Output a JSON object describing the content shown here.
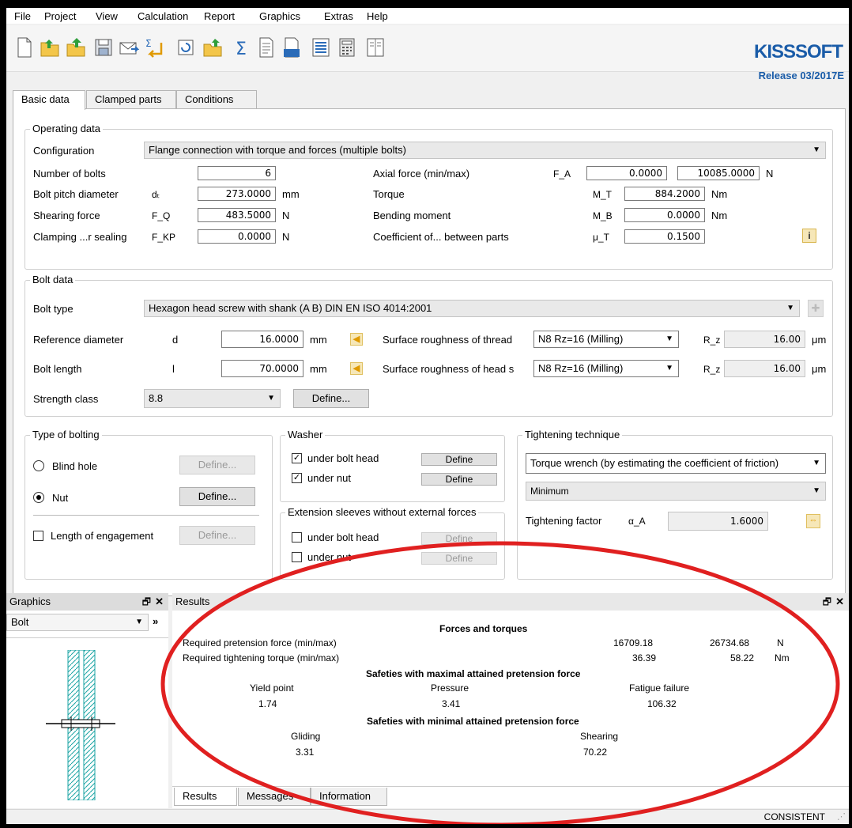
{
  "menu": [
    "File",
    "Project",
    "View",
    "Calculation",
    "Report",
    "Graphics",
    "Extras",
    "Help"
  ],
  "toolbar": {
    "icons": [
      "new-file-icon",
      "open-folder-icon",
      "open-example-icon",
      "save-icon",
      "email-icon",
      "sigma-arrow-icon",
      "rotate-icon",
      "folder-export-icon",
      "sigma-icon",
      "report-icon",
      "report-settings-icon",
      "list-icon",
      "calculator-icon",
      "book-icon"
    ]
  },
  "brand": {
    "logo": "KISSSOFT",
    "release": "Release 03/2017E",
    "accent": "#1a5ca8"
  },
  "tabs": [
    "Basic data",
    "Clamped parts",
    "Conditions"
  ],
  "operating": {
    "title": "Operating data",
    "configuration_label": "Configuration",
    "configuration_value": "Flange connection with torque and forces (multiple bolts)",
    "num_bolts_label": "Number of bolts",
    "num_bolts": "6",
    "pitch_label": "Bolt pitch diameter",
    "pitch_sym": "dₜ",
    "pitch": "273.0000",
    "pitch_unit": "mm",
    "shear_label": "Shearing force",
    "shear_sym": "F_Q",
    "shear": "483.5000",
    "shear_unit": "N",
    "clamp_label": "Clamping ...r sealing",
    "clamp_sym": "F_KP",
    "clamp": "0.0000",
    "clamp_unit": "N",
    "axial_label": "Axial force (min/max)",
    "axial_sym": "F_A",
    "axial_min": "0.0000",
    "axial_max": "10085.0000",
    "axial_unit": "N",
    "torque_label": "Torque",
    "torque_sym": "M_T",
    "torque": "884.2000",
    "torque_unit": "Nm",
    "bending_label": "Bending moment",
    "bending_sym": "M_B",
    "bending": "0.0000",
    "bending_unit": "Nm",
    "coef_label": "Coefficient of... between parts",
    "coef_sym": "μ_T",
    "coef": "0.1500"
  },
  "bolt": {
    "title": "Bolt data",
    "type_label": "Bolt type",
    "type_value": "Hexagon head screw with shank (A B) DIN EN ISO 4014:2001",
    "refdia_label": "Reference diameter",
    "refdia_sym": "d",
    "refdia": "16.0000",
    "refdia_unit": "mm",
    "length_label": "Bolt length",
    "length_sym": "l",
    "length": "70.0000",
    "length_unit": "mm",
    "strength_label": "Strength class",
    "strength_value": "8.8",
    "define": "Define...",
    "rough_thread_label": "Surface roughness of thread",
    "rough_thread_value": "N8  Rz=16  (Milling)",
    "rough_head_label": "Surface roughness of head s",
    "rough_head_value": "N8  Rz=16  (Milling)",
    "rz_sym": "R_z",
    "rz_thread": "16.00",
    "rz_head": "16.00",
    "rz_unit": "μm"
  },
  "bolting": {
    "title": "Type of bolting",
    "blind": "Blind hole",
    "nut": "Nut",
    "engagement": "Length of engagement",
    "define": "Define..."
  },
  "washer": {
    "title": "Washer",
    "head": "under bolt head",
    "nut": "under nut",
    "define": "Define",
    "sleeves_title": "Extension sleeves without external forces"
  },
  "tightening": {
    "title": "Tightening technique",
    "technique": "Torque wrench (by estimating the coefficient of friction)",
    "level": "Minimum",
    "factor_label": "Tightening factor",
    "factor_sym": "α_A",
    "factor": "1.6000"
  },
  "graphics_panel": {
    "title": "Graphics",
    "selector": "Bolt"
  },
  "results": {
    "title": "Results",
    "forces_title": "Forces and torques",
    "pretension_label": "Required pretension force (min/max)",
    "pretension_min": "16709.18",
    "pretension_max": "26734.68",
    "pretension_unit": "N",
    "torque_label": "Required tightening torque (min/max)",
    "torque_min": "36.39",
    "torque_max": "58.22",
    "torque_unit": "Nm",
    "max_title": "Safeties with maximal attained pretension force",
    "yield_label": "Yield point",
    "yield": "1.74",
    "pressure_label": "Pressure",
    "pressure": "3.41",
    "fatigue_label": "Fatigue failure",
    "fatigue": "106.32",
    "min_title": "Safeties with minimal attained pretension force",
    "gliding_label": "Gliding",
    "gliding": "3.31",
    "shearing_label": "Shearing",
    "shearing": "70.22",
    "bottom_tabs": [
      "Results",
      "Messages",
      "Information"
    ]
  },
  "status": "CONSISTENT",
  "annotation_color": "#e02020"
}
